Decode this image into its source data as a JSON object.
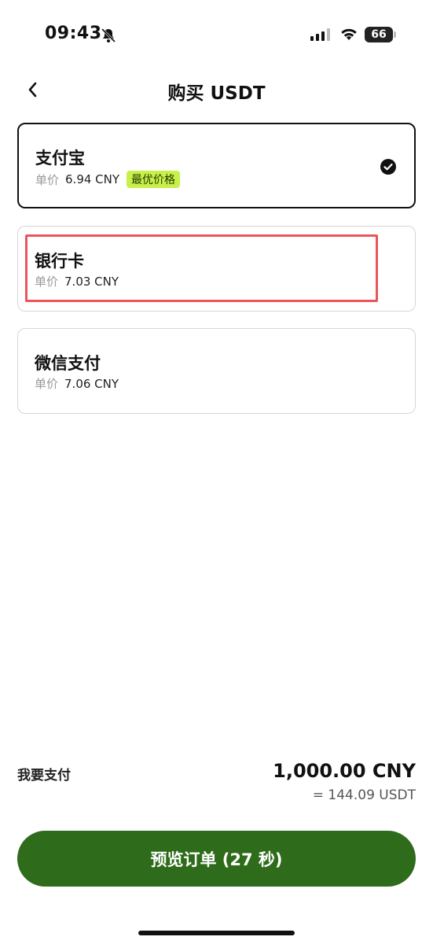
{
  "status_bar": {
    "time": "09:43",
    "battery": "66",
    "icons": [
      "bell-off-icon",
      "signal-icon",
      "wifi-icon",
      "battery-icon"
    ]
  },
  "header": {
    "title": "购买 USDT",
    "back_icon": "chevron-left-icon"
  },
  "payment_methods": [
    {
      "name": "支付宝",
      "price_label": "单价",
      "price": "6.94 CNY",
      "badge": "最优价格",
      "selected": true
    },
    {
      "name": "银行卡",
      "price_label": "单价",
      "price": "7.03 CNY",
      "selected": false
    },
    {
      "name": "微信支付",
      "price_label": "单价",
      "price": "7.06 CNY",
      "selected": false
    }
  ],
  "summary": {
    "pay_label": "我要支付",
    "amount": "1,000.00 CNY",
    "usdt_equivalent": "= 144.09 USDT"
  },
  "action": {
    "button_label": "预览订单 (27 秒)"
  },
  "colors": {
    "primary_button": "#2e6b1a",
    "badge_bg": "#c6f14a",
    "highlight": "#e8565a"
  }
}
